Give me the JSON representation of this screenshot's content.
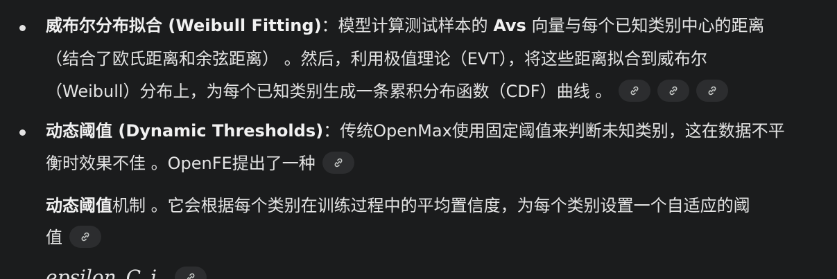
{
  "item1": {
    "title": "威布尔分布拟合 (Weibull Fitting)",
    "line1_rest": "：模型计算测试样本的 ",
    "line1_bold2": "Avs",
    "line1_tail": " 向量与每个已知类别中心的距离",
    "line2": "（结合了欧氏距离和余弦距离） 。然后，利用极值理论（EVT），将这些距离拟合到威布尔",
    "line3": "（Weibull）分布上，为每个已知类别生成一条累积分布函数（CDF）曲线 。"
  },
  "item2": {
    "title": "动态阈值 (Dynamic Thresholds)",
    "line1_rest": "：传统OpenMax使用固定阈值来判断未知类别，这在数据不平",
    "line2": "衡时效果不佳 。OpenFE提出了一种"
  },
  "para3": {
    "bold": "动态阈值",
    "line1_rest": "机制 。它会根据每个类别在训练过程中的平均置信度，为每个类别设置一个自适应的阈",
    "line2": "值"
  },
  "math_line": {
    "text": "epsilon_C_i"
  },
  "icons": {
    "citation": "link-icon"
  }
}
